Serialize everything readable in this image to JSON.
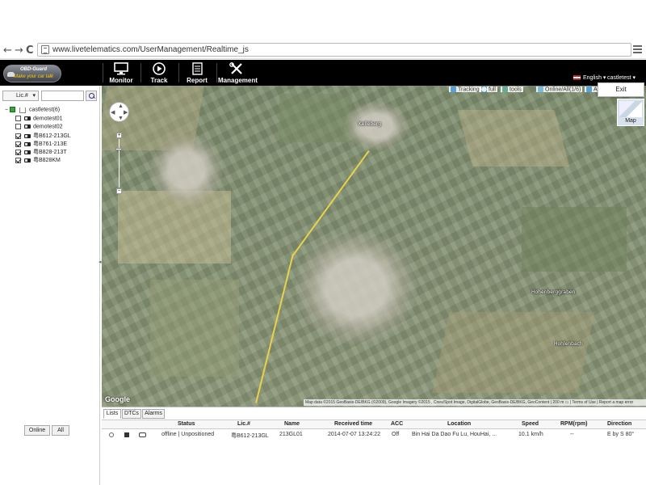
{
  "browser": {
    "url": "www.livetelematics.com/UserManagement/Realtime_js",
    "back": "←",
    "forward": "→",
    "reload": "C"
  },
  "app": {
    "logo_line1": "OBD-Guard",
    "logo_line2": "Make your car talk",
    "nav": [
      {
        "label": "Monitor",
        "icon": "monitor-icon"
      },
      {
        "label": "Track",
        "icon": "play-icon"
      },
      {
        "label": "Report",
        "icon": "report-icon"
      },
      {
        "label": "Management",
        "icon": "tools-icon"
      }
    ],
    "language": "English",
    "language_arrow": "▾",
    "user": "castletest",
    "user_arrow": "▾"
  },
  "sidebar": {
    "search_field": "Lic.#",
    "search_value": "",
    "root": "castletest(6)",
    "vehicles": [
      {
        "name": "demotest01",
        "checked": false
      },
      {
        "name": "demotest02",
        "checked": false
      },
      {
        "name": "粤B612-213GL",
        "checked": true
      },
      {
        "name": "粤B761-213E",
        "checked": true
      },
      {
        "name": "粤B828-213T",
        "checked": true
      },
      {
        "name": "粤B828KM",
        "checked": true
      }
    ],
    "btn_online": "Online",
    "btn_all": "All",
    "splitter": "◂"
  },
  "map": {
    "toolbar": {
      "tracking": "Tracking",
      "full": "full",
      "tools": "tools",
      "online_all": "Online/All(1/6)",
      "al": "Al"
    },
    "exit": "Exit",
    "map_type": "Map",
    "zoom_in": "+",
    "zoom_out": "−",
    "google": "Google",
    "attribution": "Map data ©2015 GeoBasis-DE/BKG (©2009), Google Imagery ©2015 , Cnes/Spot Image, DigitalGlobe, GeoBasis-DE/BKG, GeoContent | 200 m ▭ | Terms of Use | Report a map error",
    "labels": [
      "Kelleberg",
      "Hohenberggraben",
      "Hohlenbach"
    ]
  },
  "bottom": {
    "tabs": [
      "Lists",
      "DTCs",
      "Alarms"
    ],
    "columns": [
      "Status",
      "Lic.#",
      "Name",
      "Received time",
      "ACC",
      "Location",
      "Speed",
      "RPM(rpm)",
      "Direction"
    ],
    "rows": [
      {
        "status": "offline | Unpositioned",
        "lic": "粤B612-213GL",
        "name": "213GL01",
        "received": "2014-07-07 13:24:22",
        "acc": "Off",
        "location": "Bin Hai Da Dao Fu Lu, HouHai, ...",
        "speed": "10.1 km/h",
        "rpm": "--",
        "direction": "E by S 80°"
      }
    ]
  },
  "colors": {
    "header_bg": "#000000",
    "accent_green": "#33aa33",
    "road_yellow": "#e8d34a"
  }
}
